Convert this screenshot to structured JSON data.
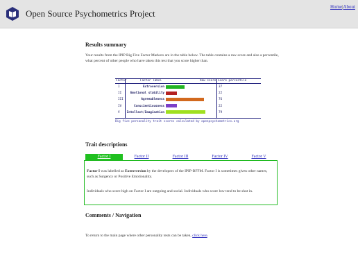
{
  "header": {
    "site_title": "Open Source Psychometrics Project",
    "nav": {
      "home": "Home",
      "separator": "|",
      "about": "About"
    }
  },
  "results": {
    "heading": "Results summary",
    "intro": "Your results from the IPIP Big Five Factor Markers are in the table below. The table contains a raw score and also a percentile, what percent of other people who have taken this test that you score higher than.",
    "table": {
      "headers": {
        "factor": "Factor",
        "label": "Factor label",
        "raw": "Raw score",
        "percentile": "Score percentile"
      },
      "caption": "Big five personality trait scores calculated by openpsychometrics.org",
      "rows": [
        {
          "factor": "I",
          "label": "Extroversion",
          "score": 37,
          "color": "#22b422"
        },
        {
          "factor": "II",
          "label": "Emotional stability",
          "score": 22,
          "color": "#b42222"
        },
        {
          "factor": "III",
          "label": "Agreeableness",
          "score": 76,
          "color": "#d2691e"
        },
        {
          "factor": "IV",
          "label": "Conscientiousness",
          "score": 22,
          "color": "#7b3fc8"
        },
        {
          "factor": "V",
          "label": "Intellect/Imagination",
          "score": 79,
          "color": "#a0e020"
        }
      ]
    }
  },
  "traits": {
    "heading": "Trait descriptions",
    "tabs": [
      "Factor I",
      "Factor II",
      "Factor III",
      "Factor IV",
      "Factor V"
    ],
    "active_tab": 0,
    "panel": {
      "p1_start": "Factor I",
      "p1_mid": " was labelled as ",
      "p1_bold": "Extroversion",
      "p1_end": " by the developers of the IPIP-BFFM. Factor I is sometimes given other names, such as Surgency or Positive Emotionality.",
      "p2": "Individuals who score high on Factor I are outgoing and social. Individuals who score low tend to be shut in."
    }
  },
  "comments": {
    "heading": "Comments / Navigation",
    "nav_text": "To return to the main page where other personality tests can be taken, ",
    "nav_link": "click here",
    "nav_end": "."
  },
  "icons": {
    "logo": "book-logo-icon"
  },
  "colors": {
    "header_bg": "#e4e4e4",
    "link": "#2b2bbd",
    "accent_green": "#20c020"
  }
}
